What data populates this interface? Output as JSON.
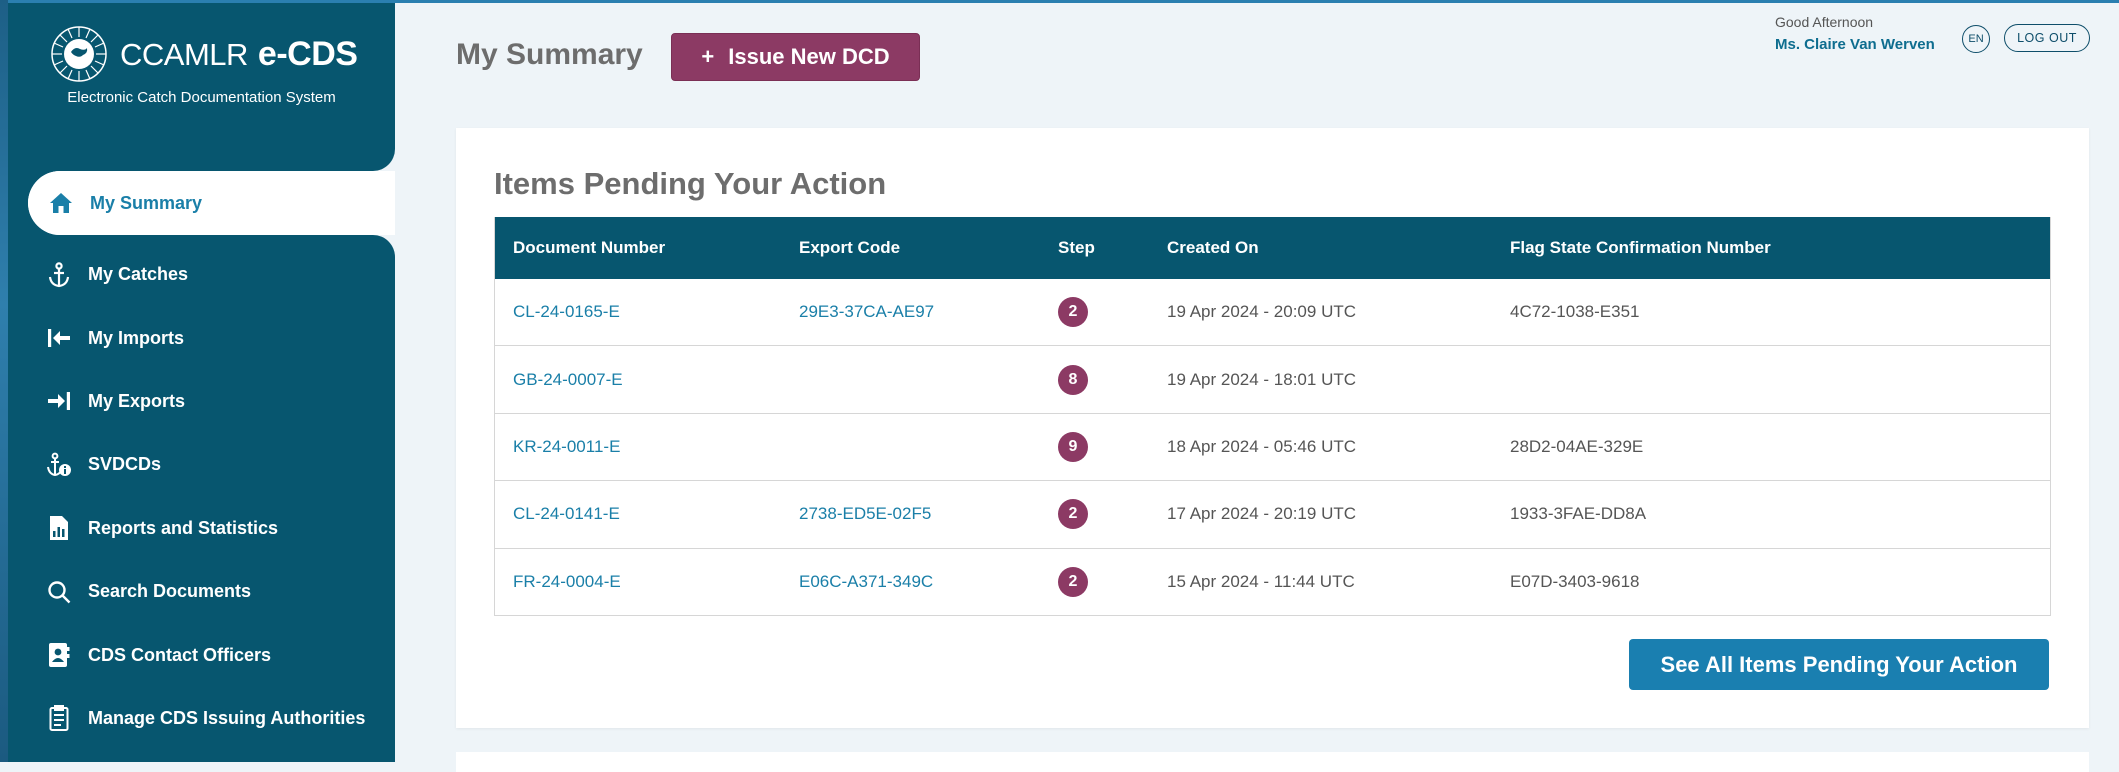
{
  "brand": {
    "name_light": "CCAMLR",
    "name_bold": "e-CDS",
    "subtitle": "Electronic Catch Documentation System"
  },
  "sidebar": {
    "active_item": {
      "label": "My Summary",
      "icon": "home-icon"
    },
    "items": [
      {
        "label": "My Catches",
        "icon": "anchor-icon"
      },
      {
        "label": "My Imports",
        "icon": "import-icon"
      },
      {
        "label": "My Exports",
        "icon": "export-icon"
      },
      {
        "label": "SVDCDs",
        "icon": "anchor-info-icon"
      },
      {
        "label": "Reports and Statistics",
        "icon": "report-icon"
      },
      {
        "label": "Search Documents",
        "icon": "search-icon"
      },
      {
        "label": "CDS Contact Officers",
        "icon": "contact-card-icon"
      },
      {
        "label": "Manage CDS Issuing Authorities",
        "icon": "checklist-icon"
      }
    ]
  },
  "header": {
    "title": "My Summary",
    "issue_button": {
      "symbol": "+",
      "label": "Issue New DCD"
    },
    "greeting": "Good Afternoon",
    "user_name": "Ms. Claire Van Werven",
    "language": "EN",
    "logout_label": "LOG OUT"
  },
  "pending": {
    "title": "Items Pending Your Action",
    "columns": [
      "Document Number",
      "Export Code",
      "Step",
      "Created On",
      "Flag State Confirmation Number"
    ],
    "rows": [
      {
        "doc": "CL-24-0165-E",
        "export_code": "29E3-37CA-AE97",
        "step": "2",
        "created": "19 Apr 2024 - 20:09 UTC",
        "flag": "4C72-1038-E351"
      },
      {
        "doc": "GB-24-0007-E",
        "export_code": "",
        "step": "8",
        "created": "19 Apr 2024 - 18:01 UTC",
        "flag": ""
      },
      {
        "doc": "KR-24-0011-E",
        "export_code": "",
        "step": "9",
        "created": "18 Apr 2024 - 05:46 UTC",
        "flag": "28D2-04AE-329E"
      },
      {
        "doc": "CL-24-0141-E",
        "export_code": "2738-ED5E-02F5",
        "step": "2",
        "created": "17 Apr 2024 - 20:19 UTC",
        "flag": "1933-3FAE-DD8A"
      },
      {
        "doc": "FR-24-0004-E",
        "export_code": "E06C-A371-349C",
        "step": "2",
        "created": "15 Apr 2024 - 11:44 UTC",
        "flag": "E07D-3403-9618"
      }
    ],
    "see_all_label": "See All Items Pending Your Action"
  },
  "colors": {
    "sidebar": "#07566f",
    "accent_maroon": "#8c3a64",
    "link_blue": "#1a7fa8",
    "button_blue": "#1a7fb0",
    "page_bg": "#eef4f8"
  }
}
